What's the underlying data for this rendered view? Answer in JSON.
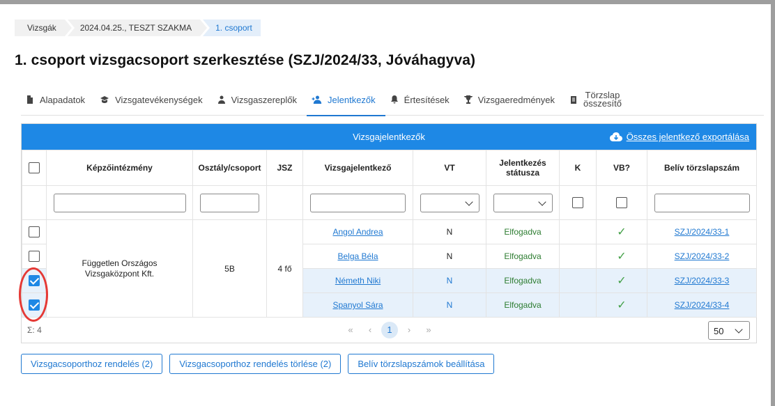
{
  "breadcrumb": [
    "Vizsgák",
    "2024.04.25., TESZT SZAKMA",
    "1. csoport"
  ],
  "page_title": "1. csoport vizsgacsoport szerkesztése (SZJ/2024/33, Jóváhagyva)",
  "tabs": [
    {
      "label": "Alapadatok",
      "icon": "document-icon"
    },
    {
      "label": "Vizsgatevékenységek",
      "icon": "graduation-cap-icon"
    },
    {
      "label": "Vizsgaszereplők",
      "icon": "person-icon"
    },
    {
      "label": "Jelentkezők",
      "icon": "person-add-icon",
      "active": true
    },
    {
      "label": "Értesítések",
      "icon": "bell-icon"
    },
    {
      "label": "Vizsgaeredmények",
      "icon": "trophy-icon"
    },
    {
      "label_line1": "Törzslap",
      "label_line2": "összesítő",
      "icon": "report-icon"
    }
  ],
  "panel": {
    "title": "Vizsgajelentkezők",
    "export_label": "Összes jelentkező exportálása"
  },
  "columns": [
    "Képzőintézmény",
    "Osztály/csoport",
    "JSZ",
    "Vizsgajelentkező",
    "VT",
    "Jelentkezés státusza",
    "K",
    "VB?",
    "Belív törzslapszám"
  ],
  "group": {
    "institution": "Független Országos Vizsgaközpont Kft.",
    "class": "5B",
    "jsz": "4 fő"
  },
  "rows": [
    {
      "name": "Angol Andrea",
      "vt": "N",
      "status": "Elfogadva",
      "vb": "✓",
      "belív": "SZJ/2024/33-1",
      "checked": false
    },
    {
      "name": "Belga Béla",
      "vt": "N",
      "status": "Elfogadva",
      "vb": "✓",
      "belív": "SZJ/2024/33-2",
      "checked": false
    },
    {
      "name": "Németh Niki",
      "vt": "N",
      "status": "Elfogadva",
      "vb": "✓",
      "belív": "SZJ/2024/33-3",
      "checked": true
    },
    {
      "name": "Spanyol Sára",
      "vt": "N",
      "status": "Elfogadva",
      "vb": "✓",
      "belív": "SZJ/2024/33-4",
      "checked": true
    }
  ],
  "footer": {
    "sum": "Σ: 4",
    "pager": [
      "«",
      "‹",
      "1",
      "›",
      "»"
    ],
    "page_size": "50"
  },
  "actions": [
    "Vizsgacsoporthoz rendelés (2)",
    "Vizsgacsoporthoz rendelés törlése (2)",
    "Belív törzslapszámok beállítása"
  ],
  "colors": {
    "primary": "#1e88e5",
    "link": "#1f78d1",
    "status_green": "#2e7d32",
    "highlight": "#e7f1fb",
    "annotation_red": "#e53935"
  }
}
